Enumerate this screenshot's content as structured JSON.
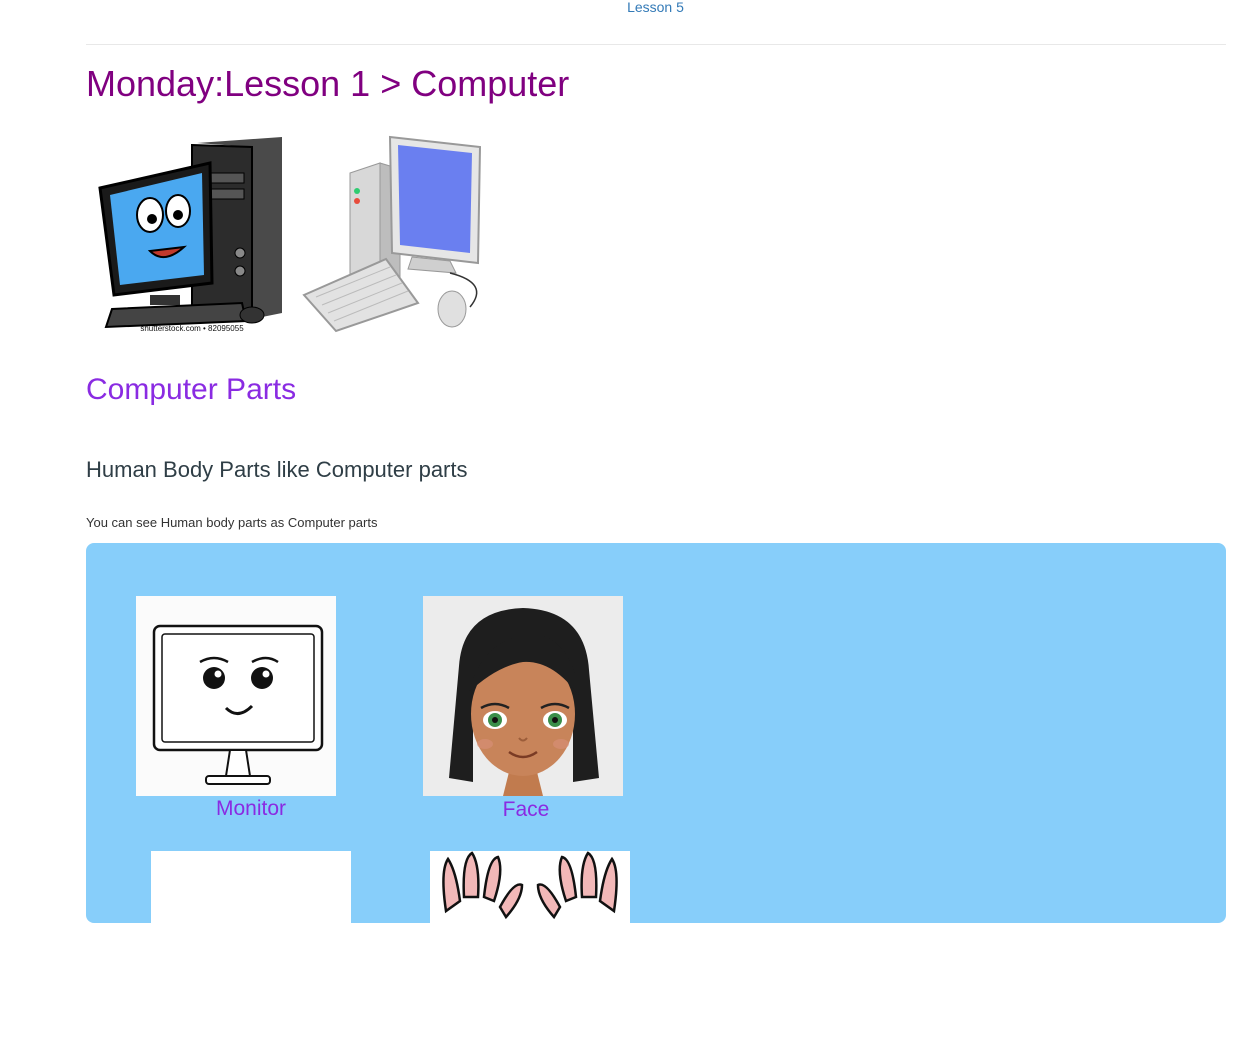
{
  "nav": {
    "top_link": "Lesson 5"
  },
  "page": {
    "title": "Monday:Lesson 1 > Computer"
  },
  "hero": {
    "images": [
      {
        "icon": "cartoon-computer-icon",
        "caption": "shutterstock.com • 82095055"
      },
      {
        "icon": "desktop-computer-icon"
      }
    ]
  },
  "section": {
    "heading": "Computer Parts",
    "subheading": "Human Body Parts like Computer parts",
    "intro": "You can see Human body parts as Computer parts"
  },
  "cards": [
    {
      "label": "Monitor",
      "icon": "monitor-face-icon"
    },
    {
      "label": "Face",
      "icon": "girl-face-icon"
    },
    {
      "label": "",
      "icon": "blank-card"
    },
    {
      "label": "",
      "icon": "hands-icon"
    }
  ],
  "colors": {
    "title": "#800080",
    "heading": "#8a2be2",
    "link": "#337ab7",
    "panel": "#87cefa"
  }
}
